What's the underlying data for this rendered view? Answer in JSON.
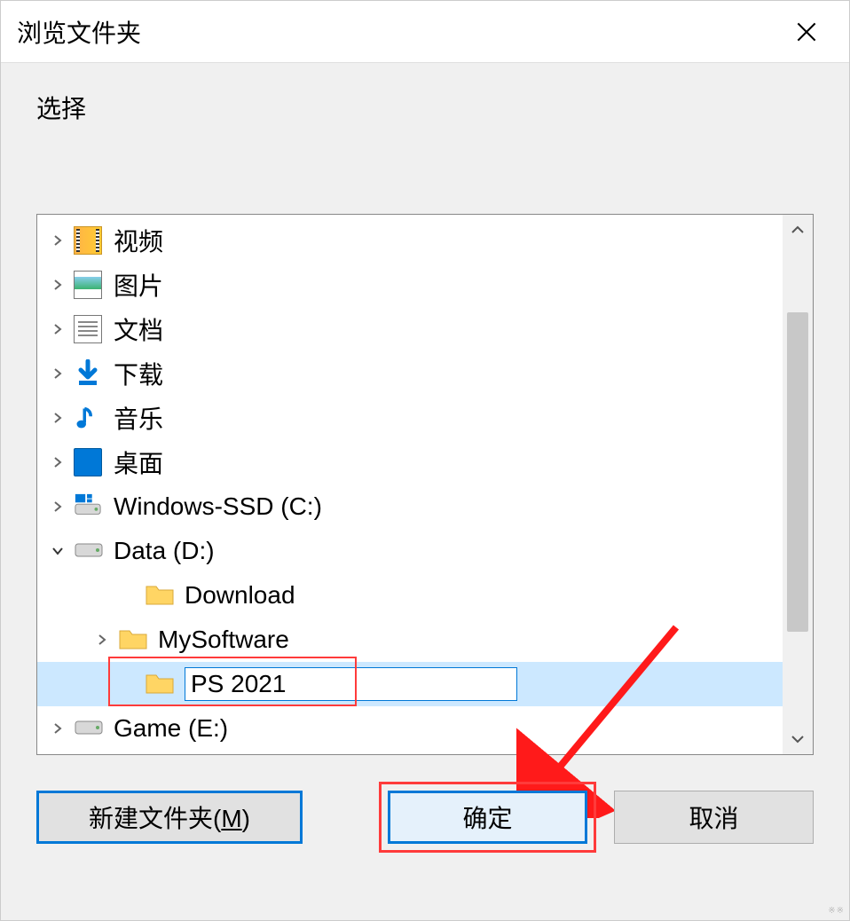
{
  "titlebar": {
    "title": "浏览文件夹"
  },
  "prompt": "选择",
  "tree": {
    "items": [
      {
        "label": "视频",
        "icon": "video",
        "expand": ">",
        "indent": 0
      },
      {
        "label": "图片",
        "icon": "image",
        "expand": ">",
        "indent": 0
      },
      {
        "label": "文档",
        "icon": "document",
        "expand": ">",
        "indent": 0
      },
      {
        "label": "下载",
        "icon": "download",
        "expand": ">",
        "indent": 0
      },
      {
        "label": "音乐",
        "icon": "music",
        "expand": ">",
        "indent": 0
      },
      {
        "label": "桌面",
        "icon": "desktop",
        "expand": ">",
        "indent": 0
      },
      {
        "label": "Windows-SSD (C:)",
        "icon": "drive-win",
        "expand": ">",
        "indent": 0
      },
      {
        "label": "Data (D:)",
        "icon": "drive",
        "expand": "v",
        "indent": 0
      },
      {
        "label": "Download",
        "icon": "folder",
        "expand": "",
        "indent": 2
      },
      {
        "label": "MySoftware",
        "icon": "folder",
        "expand": ">",
        "indent": 2,
        "offset": true
      },
      {
        "label": "PS 2021",
        "icon": "folder",
        "expand": "",
        "indent": 2,
        "editing": true,
        "selected": true
      },
      {
        "label": "Game (E:)",
        "icon": "drive",
        "expand": ">",
        "indent": 0
      }
    ]
  },
  "buttons": {
    "new_folder": "新建文件夹(",
    "new_folder_key": "M",
    "new_folder_suffix": ")",
    "ok": "确定",
    "cancel": "取消"
  }
}
